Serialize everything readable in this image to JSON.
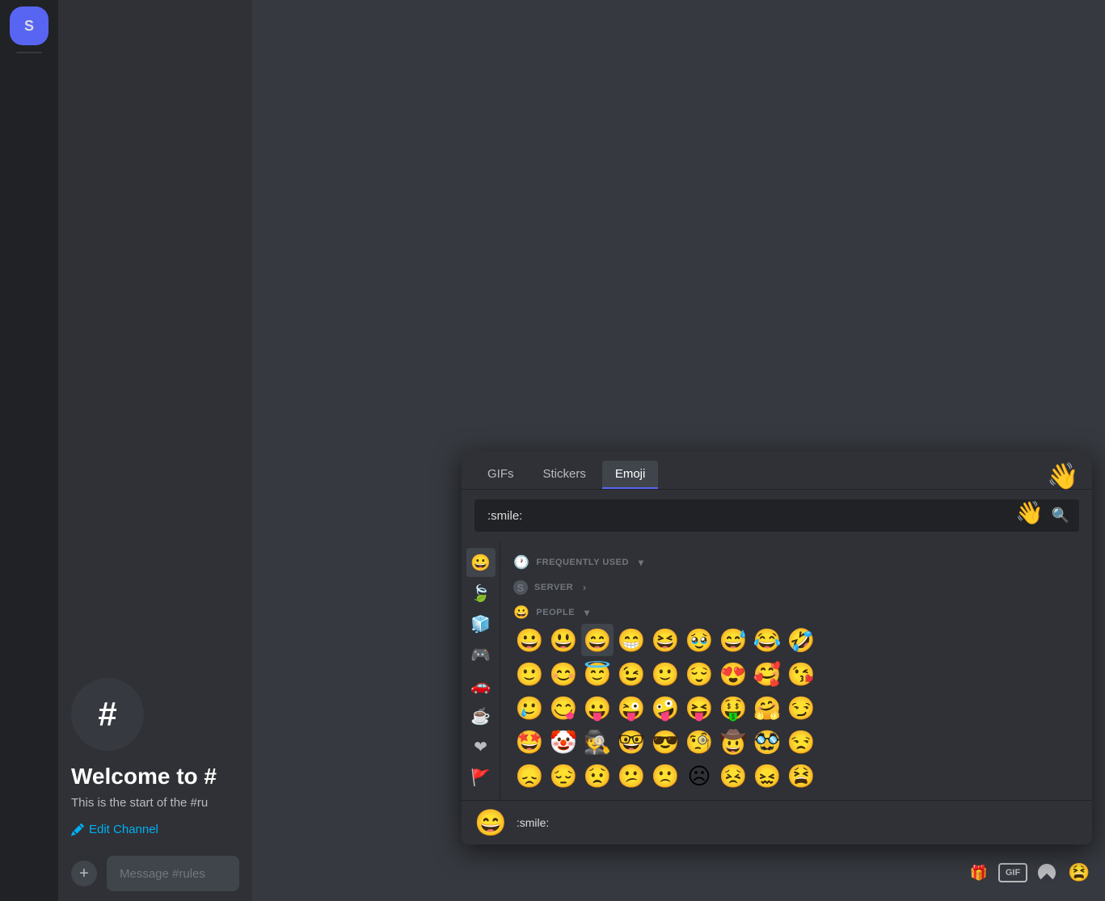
{
  "serverSidebar": {
    "serverIcon": "S"
  },
  "channelSidebar": {
    "welcomeTitle": "Welcome to #",
    "welcomeDesc": "This is the start of the #ru",
    "editChannelLabel": "Edit Channel",
    "channelHash": "#",
    "messagePlaceholder": "Message #rules"
  },
  "emojiPicker": {
    "tabs": [
      {
        "label": "GIFs",
        "active": false
      },
      {
        "label": "Stickers",
        "active": false
      },
      {
        "label": "Emoji",
        "active": true
      }
    ],
    "searchPlaceholder": ":smile:",
    "waveEmoji": "👋",
    "sections": [
      {
        "id": "frequently-used",
        "icon": "🕐",
        "label": "FREQUENTLY USED",
        "chevron": "▾",
        "collapsed": false
      },
      {
        "id": "server",
        "icon": "S",
        "label": "SERVER",
        "chevron": "›",
        "collapsed": false
      },
      {
        "id": "people",
        "icon": "😀",
        "label": "PEOPLE",
        "chevron": "▾",
        "collapsed": false
      }
    ],
    "emojiRows": [
      [
        "😀",
        "😃",
        "😄",
        "😁",
        "😆",
        "🥹",
        "😅",
        "😂",
        "🤣"
      ],
      [
        "🙂",
        "😊",
        "😇",
        "😉",
        "🙂",
        "😌",
        "😍",
        "🥰",
        "😘"
      ],
      [
        "🥲",
        "😋",
        "😛",
        "😜",
        "🤪",
        "😝",
        "🤑",
        "🤗",
        "😏"
      ],
      [
        "🤩",
        "🤡",
        "🕵",
        "🤓",
        "😎",
        "🧐",
        "🤠",
        "🥸",
        "😒"
      ],
      [
        "😞",
        "😔",
        "😟",
        "😕",
        "🙁",
        "☹",
        "😣",
        "😖",
        "😫"
      ]
    ],
    "selectedEmoji": "😄",
    "previewEmoji": "😄",
    "previewName": ":smile:",
    "categoryIcons": [
      "😀",
      "🍃",
      "🧊",
      "🎮",
      "🚗",
      "☕",
      "❤",
      "🚩"
    ]
  },
  "messageToolbar": {
    "giftLabel": "Gift",
    "gifLabel": "GIF",
    "stickerLabel": "Sticker",
    "emojiLabel": "Emoji"
  }
}
